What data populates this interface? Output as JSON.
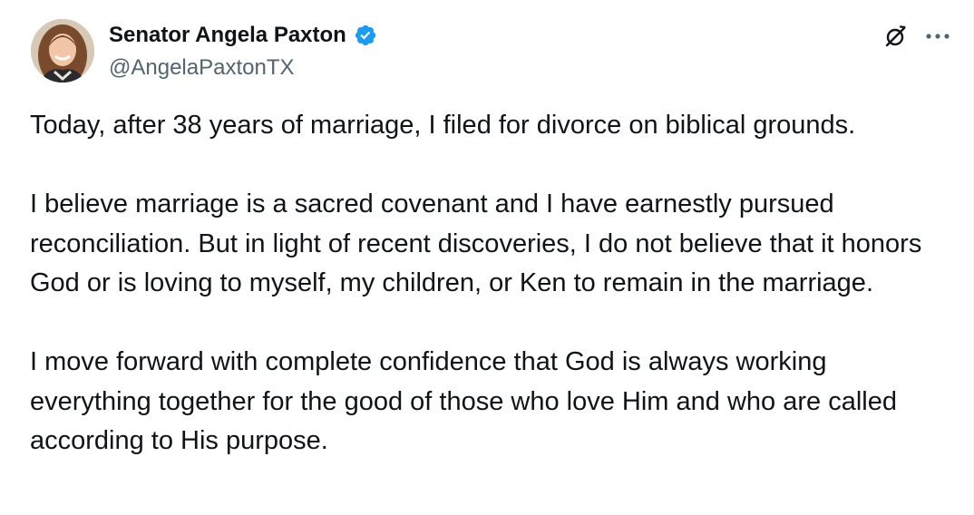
{
  "author": {
    "display_name": "Senator Angela Paxton",
    "handle": "@AngelaPaxtonTX",
    "verified_icon": "verified-badge-icon",
    "avatar_icon": "profile-photo"
  },
  "actions": {
    "grok_icon": "grok-icon",
    "more_icon": "more-horizontal-icon"
  },
  "tweet": {
    "paragraphs": [
      "Today, after 38 years of marriage, I filed for divorce on biblical grounds.",
      "I believe marriage is a sacred covenant and I have earnestly pursued reconciliation. But in light of recent discoveries, I do not believe that it honors God or is loving to myself, my children, or Ken to remain in the marriage.",
      "I move forward with complete confidence that God is always working everything together for the good of those who love Him and who are called according to His purpose."
    ]
  },
  "colors": {
    "text": "#0f1419",
    "secondary": "#536471",
    "verified_blue": "#1d9bf0",
    "background": "#ffffff"
  }
}
